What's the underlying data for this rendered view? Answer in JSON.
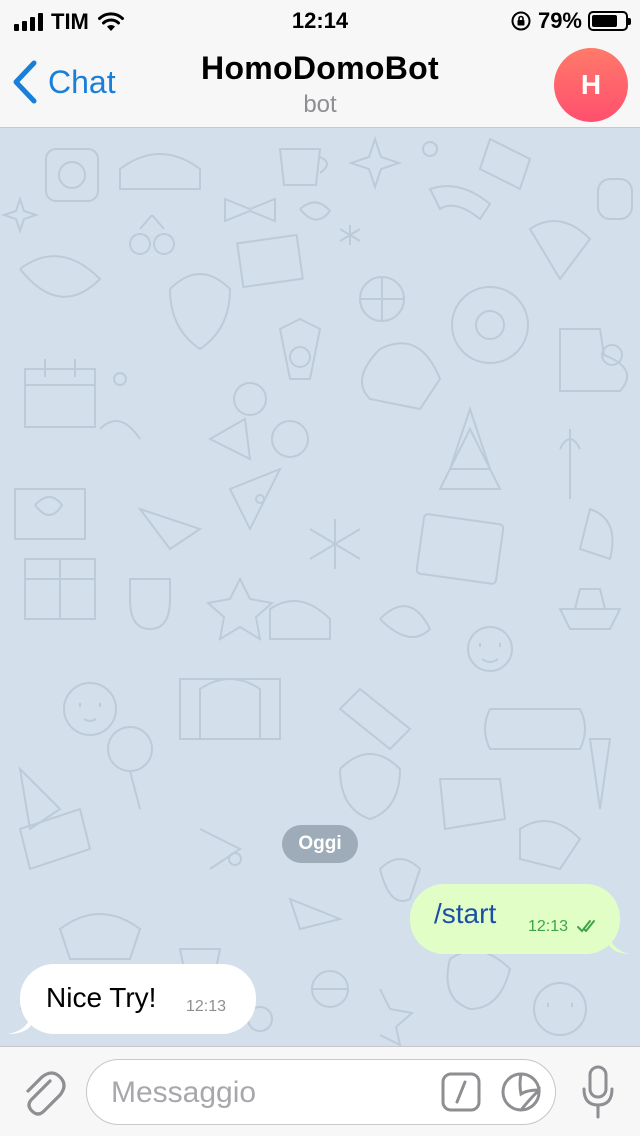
{
  "status_bar": {
    "carrier": "TIM",
    "time": "12:14",
    "battery_percent": "79%",
    "battery_level": 0.79,
    "icons": [
      "signal-icon",
      "wifi-icon",
      "rotation-lock-icon",
      "battery-icon"
    ]
  },
  "nav": {
    "back_label": "Chat",
    "title": "HomoDomoBot",
    "subtitle": "bot",
    "avatar_letter": "H",
    "avatar_gradient": [
      "#ff7a6a",
      "#ff4f6e"
    ]
  },
  "chat": {
    "date_label": "Oggi",
    "messages": [
      {
        "direction": "outgoing",
        "text": "/start",
        "time": "12:13",
        "status": "read"
      },
      {
        "direction": "incoming",
        "text": "Nice Try!",
        "time": "12:13"
      }
    ]
  },
  "input": {
    "placeholder": "Messaggio",
    "icons": [
      "paperclip-icon",
      "command-icon",
      "sticker-icon",
      "microphone-icon"
    ]
  },
  "colors": {
    "accent": "#1a7fd8",
    "outgoing_bubble": "#e1fec6",
    "incoming_bubble": "#ffffff",
    "chat_background": "#d3dfeb"
  }
}
